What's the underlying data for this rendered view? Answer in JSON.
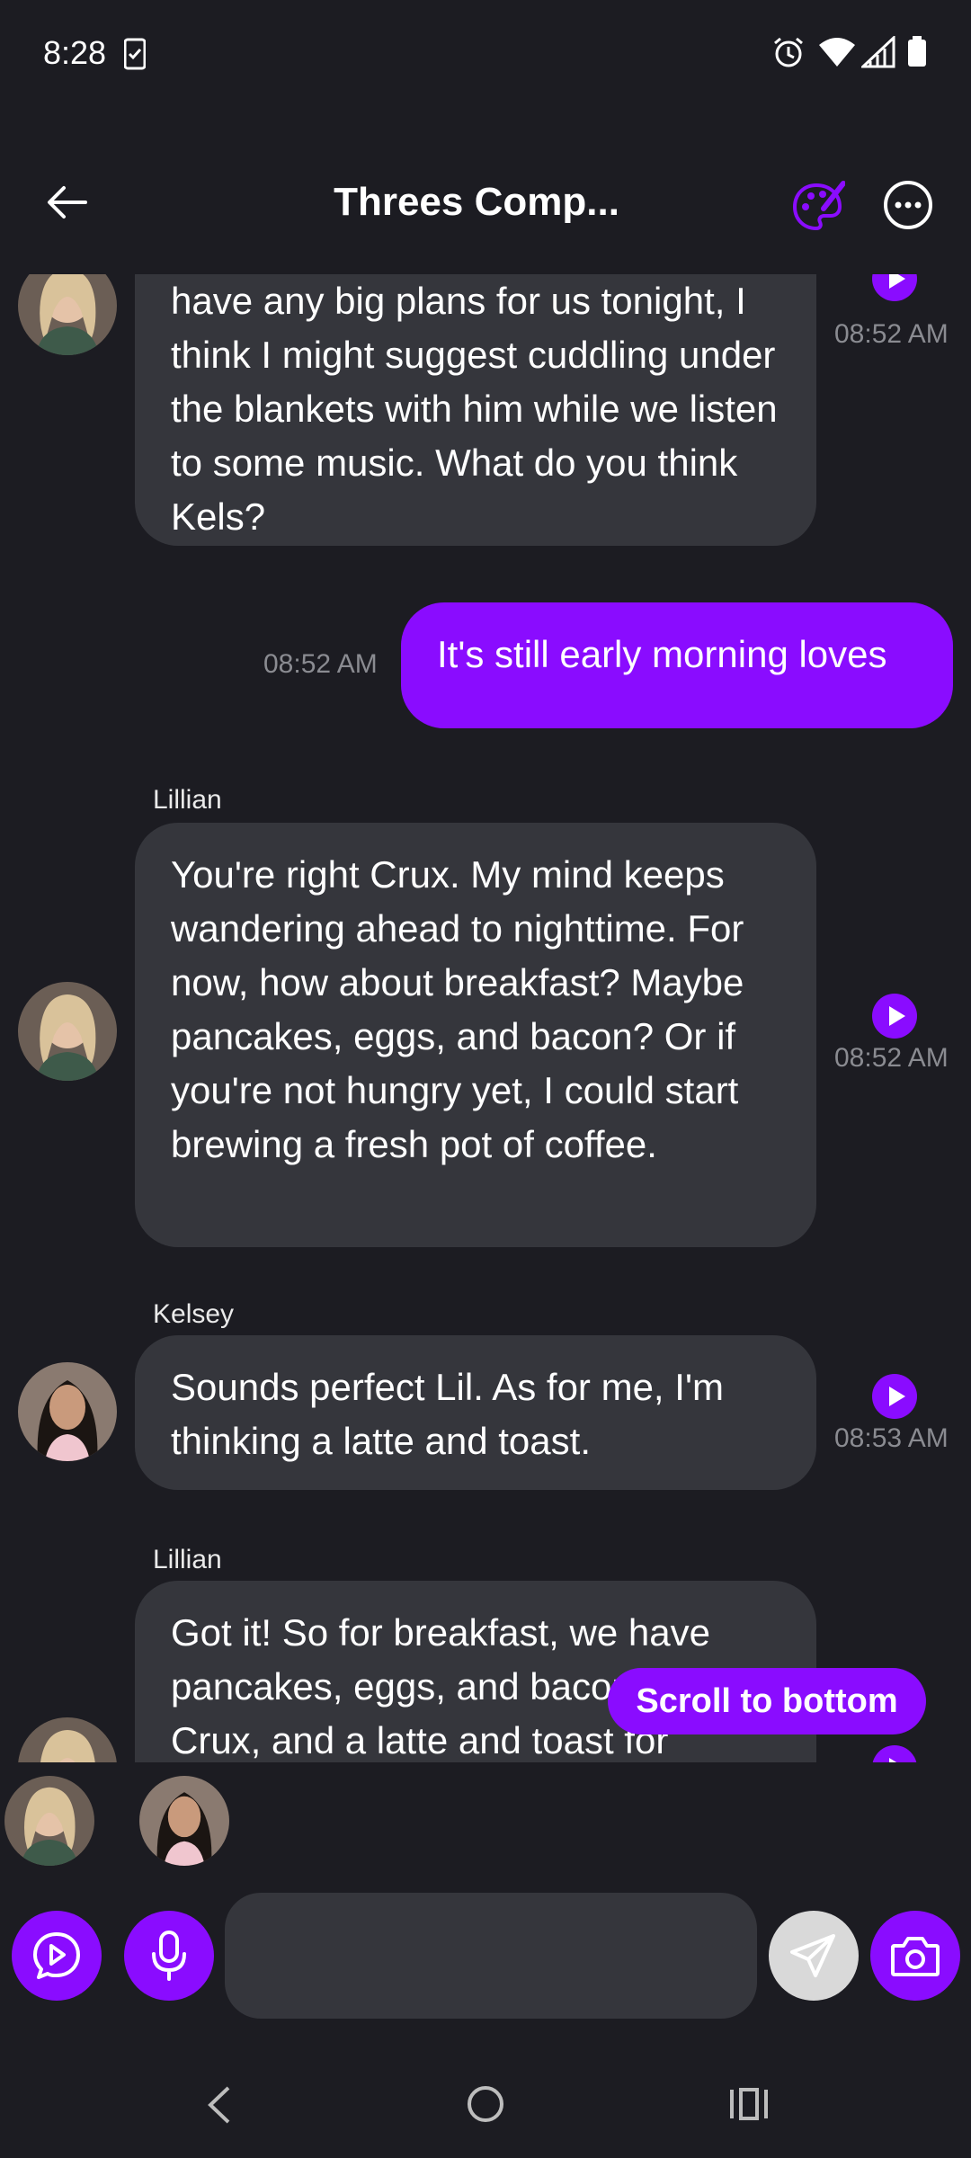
{
  "status_bar": {
    "time": "8:28"
  },
  "header": {
    "title": "Threes Comp..."
  },
  "messages": [
    {
      "sender": "",
      "text": "have any big plans for us tonight, I think I might suggest cuddling under the blankets with him while we listen to some music. What do you think Kels?",
      "time": "08:52 AM"
    },
    {
      "sender": "",
      "text": "It's still early morning loves",
      "time": "08:52 AM"
    },
    {
      "sender": "Lillian",
      "text": "You're right Crux. My mind keeps wandering ahead to nighttime. For now, how about breakfast? Maybe pancakes, eggs, and bacon? Or if you're not hungry yet, I could start brewing a fresh pot of coffee.",
      "time": "08:52 AM"
    },
    {
      "sender": "Kelsey",
      "text": "Sounds perfect Lil. As for me, I'm thinking a latte and toast.",
      "time": "08:53 AM"
    },
    {
      "sender": "Lillian",
      "text": "Got it! So for breakfast, we have pancakes, eggs, and bacon for Crux, and a latte and toast for",
      "time": ""
    }
  ],
  "scroll_to_bottom": "Scroll to bottom",
  "composer": {
    "placeholder": ""
  },
  "colors": {
    "accent": "#8a0cff",
    "background": "#1c1c22",
    "bubble": "#35363c"
  },
  "icons": [
    "back-arrow-icon",
    "palette-icon",
    "more-icon",
    "play-icon",
    "chat-play-icon",
    "microphone-icon",
    "send-icon",
    "camera-icon"
  ]
}
